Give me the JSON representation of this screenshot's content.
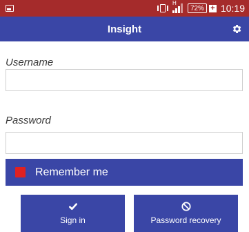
{
  "colors": {
    "status_bar_bg": "#a52b2b",
    "primary_blue": "#3a46a6",
    "checkbox_red": "#e02121",
    "white": "#ffffff"
  },
  "status_bar": {
    "notification_icon": "picture-notification-icon",
    "vibrate_icon": "vibrate-icon",
    "signal_label": "H",
    "battery_label": "72%",
    "battery_plus": "+",
    "time": "10:19"
  },
  "app_bar": {
    "title": "Insight",
    "settings_icon": "gear-icon"
  },
  "form": {
    "username_label": "Username",
    "username_value": "",
    "password_label": "Password",
    "password_value": "",
    "remember_label": "Remember me",
    "remember_checked": true
  },
  "buttons": {
    "sign_in": {
      "label": "Sign in",
      "icon": "checkmark-icon"
    },
    "password_recovery": {
      "label": "Password recovery",
      "icon": "block-icon"
    }
  }
}
